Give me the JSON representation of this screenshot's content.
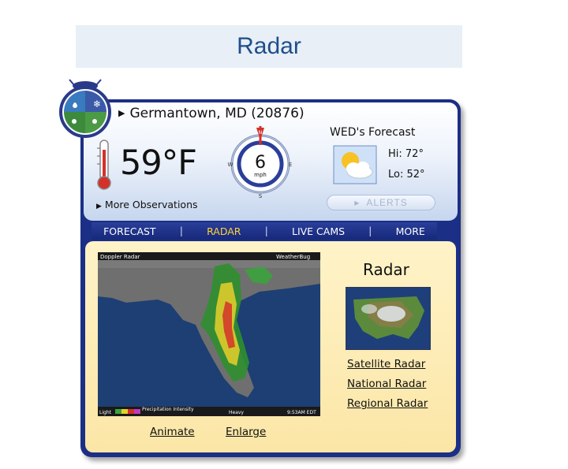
{
  "page": {
    "heading": "Radar"
  },
  "location": {
    "name": "Germantown, MD (20876)"
  },
  "current": {
    "temperature": "59°F",
    "more_observations": "More Observations"
  },
  "wind": {
    "speed": "6",
    "unit": "mph",
    "dir_n": "N",
    "dir_e": "E",
    "dir_s": "S",
    "dir_w": "W"
  },
  "forecast": {
    "title": "WED's Forecast",
    "hi": "Hi: 72°",
    "lo": "Lo: 52°",
    "icon": "partly-sunny-icon"
  },
  "alerts": {
    "label": "ALERTS"
  },
  "nav": {
    "items": [
      {
        "label": "FORECAST",
        "active": false
      },
      {
        "label": "RADAR",
        "active": true
      },
      {
        "label": "LIVE CAMS",
        "active": false
      },
      {
        "label": "MORE",
        "active": false
      }
    ],
    "separator": "|"
  },
  "radar": {
    "title": "Radar",
    "map_header_left": "Doppler Radar",
    "map_header_right": "WeatherBug",
    "map_footer_left": "Light",
    "map_footer_mid": "Precipitation Intensity",
    "map_footer_heavy": "Heavy",
    "map_footer_time": "9:53AM EDT",
    "links": [
      "Satellite Radar",
      "National Radar",
      "Regional Radar"
    ],
    "animate": "Animate",
    "enlarge": "Enlarge"
  },
  "colors": {
    "frame": "#1b2f86",
    "nav_active": "#ffd23c",
    "heading": "#1f4f8a",
    "content_bg": "#fbe6a6"
  }
}
